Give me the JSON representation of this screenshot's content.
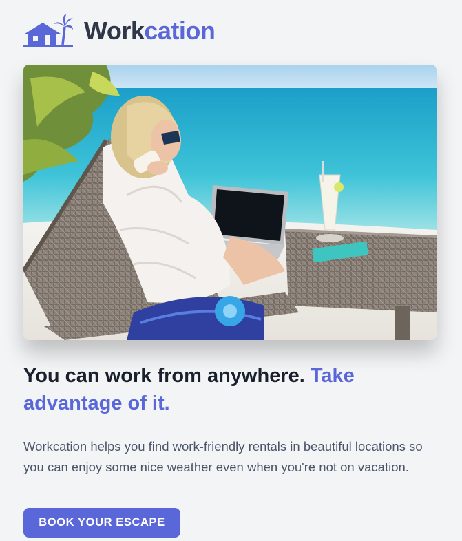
{
  "brand": {
    "name_part1": "Work",
    "name_part2": "cation",
    "logo_icon": "beach-house-palm-icon",
    "accent_color": "#5a67d8",
    "dark_color": "#2d3748"
  },
  "hero": {
    "image": "woman-working-on-laptop-beach-lounger"
  },
  "headline": {
    "text_main": "You can work from anywhere. ",
    "text_accent": "Take advantage of it."
  },
  "description": "Workcation helps you find work-friendly rentals in beautiful locations so you can enjoy some nice weather even when you're not on vacation.",
  "cta": {
    "label": "BOOK YOUR ESCAPE",
    "color": "#5a67d8"
  }
}
